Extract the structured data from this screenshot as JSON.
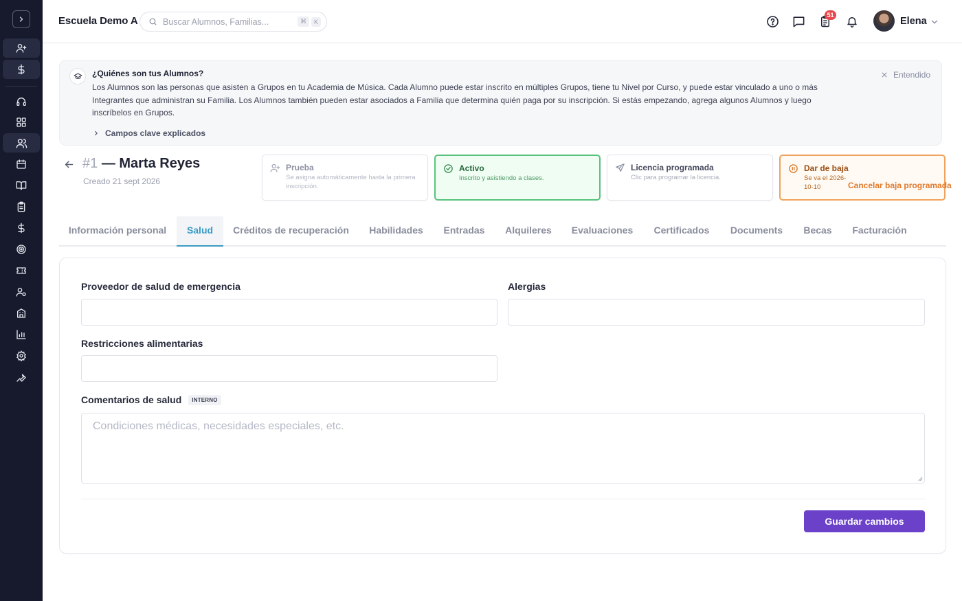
{
  "sidebar": {
    "items": [
      {
        "icon": "user-plus-icon"
      },
      {
        "icon": "dollar-icon"
      },
      {
        "icon": "headset-icon"
      },
      {
        "icon": "grid-icon"
      },
      {
        "icon": "users-icon"
      },
      {
        "icon": "calendar-icon"
      },
      {
        "icon": "book-icon"
      },
      {
        "icon": "clipboard-icon"
      },
      {
        "icon": "dollar-icon"
      },
      {
        "icon": "target-icon"
      },
      {
        "icon": "ticket-icon"
      },
      {
        "icon": "user-settings-icon"
      },
      {
        "icon": "building-icon"
      },
      {
        "icon": "bar-chart-icon"
      },
      {
        "icon": "gear-icon"
      },
      {
        "icon": "wrench-icon"
      }
    ],
    "active_item": "users-icon"
  },
  "header": {
    "brand": "Escuela Demo A",
    "search_placeholder": "Buscar Alumnos, Familias...",
    "shortcut_keys": [
      "⌘",
      "K"
    ],
    "notification_count": "51",
    "user_name": "Elena"
  },
  "banner": {
    "title": "¿Quiénes son tus Alumnos?",
    "text": "Los Alumnos son las personas que asisten a Grupos en tu Academia de Música. Cada Alumno puede estar inscrito en múltiples Grupos, tiene tu Nivel por Curso, y puede estar vinculado a uno o más Integrantes que administran su Familia. Los Alumnos también pueden estar asociados a Familia que determina quién paga por su inscripción. Si estás empezando, agrega algunos Alumnos y luego inscríbelos en Grupos.",
    "dismiss_label": "Entendido",
    "expand_label": "Campos clave explicados"
  },
  "student": {
    "number": "#1",
    "name": "— Marta Reyes",
    "created": "Creado 21 sept 2026"
  },
  "statuses": {
    "prueba": {
      "title": "Prueba",
      "desc": "Se asigna automáticamente hasta la primera inscripción."
    },
    "activo": {
      "title": "Activo",
      "desc": "Inscrito y asistiendo a clases."
    },
    "licencia": {
      "title": "Licencia programada",
      "desc": "Clic para programar la licencia."
    },
    "baja": {
      "title": "Dar de baja",
      "desc": "Se va el 2026-10-10",
      "action": "Cancelar baja programada"
    },
    "colors": {
      "activo": "#58c27d",
      "baja": "#f0a35c"
    }
  },
  "tabs": [
    {
      "label": "Información personal"
    },
    {
      "label": "Salud"
    },
    {
      "label": "Créditos de recuperación"
    },
    {
      "label": "Habilidades"
    },
    {
      "label": "Entradas"
    },
    {
      "label": "Alquileres"
    },
    {
      "label": "Evaluaciones"
    },
    {
      "label": "Certificados"
    },
    {
      "label": "Documents"
    },
    {
      "label": "Becas"
    },
    {
      "label": "Facturación"
    }
  ],
  "active_tab": "Salud",
  "form": {
    "emergency_provider_label": "Proveedor de salud de emergencia",
    "emergency_provider_value": "",
    "allergies_label": "Alergias",
    "allergies_value": "",
    "dietary_label": "Restricciones alimentarias",
    "dietary_value": "",
    "comments_label": "Comentarios de salud",
    "comments_tag": "INTERNO",
    "comments_placeholder": "Condiciones médicas, necesidades especiales, etc.",
    "save_label": "Guardar cambios"
  },
  "theme": {
    "accent": "#6b41c9",
    "tab_active": "#3a9bc4",
    "sidebar_bg": "#161a2c"
  }
}
